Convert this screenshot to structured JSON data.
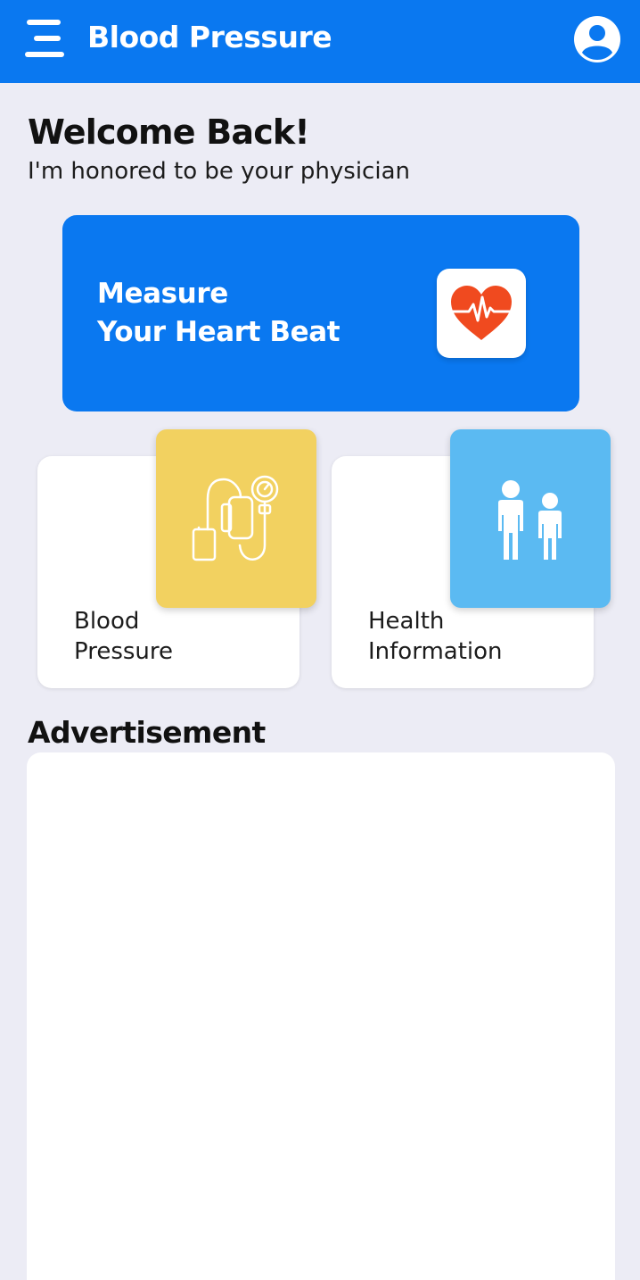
{
  "app_bar": {
    "title": "Blood Pressure",
    "background_color": "#0A78F0",
    "menu_icon": "hamburger-menu-icon",
    "account_icon": "account-circle-icon"
  },
  "welcome": {
    "title": "Welcome Back!",
    "subtitle": "I'm honored to be your physician"
  },
  "measure_card": {
    "line1": "Measure",
    "line2": "Your Heart Beat",
    "icon": "heart-pulse-icon",
    "background_color": "#0A78F0",
    "icon_color": "#F04A1F"
  },
  "features": [
    {
      "label_line1": "Blood",
      "label_line2": "Pressure",
      "icon": "blood-pressure-monitor-icon",
      "tile_color": "#F2D160"
    },
    {
      "label_line1": "Health",
      "label_line2": "Information",
      "icon": "people-icon",
      "tile_color": "#5BBAF2"
    }
  ],
  "advertisement": {
    "title": "Advertisement"
  }
}
